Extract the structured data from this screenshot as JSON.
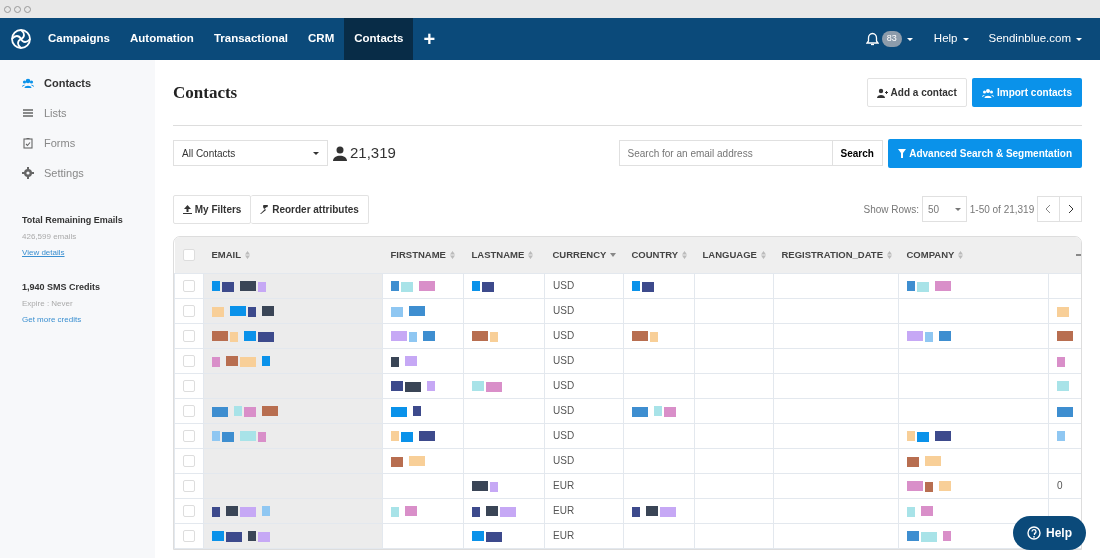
{
  "nav": {
    "items": [
      {
        "label": "Campaigns",
        "selected": false
      },
      {
        "label": "Automation",
        "selected": false
      },
      {
        "label": "Transactional",
        "selected": false
      },
      {
        "label": "CRM",
        "selected": false
      },
      {
        "label": "Contacts",
        "selected": true
      }
    ],
    "plus": "+",
    "notifications": "83",
    "help": "Help",
    "account": "Sendinblue.com"
  },
  "sidebar": {
    "items": [
      {
        "label": "Contacts",
        "selected": true
      },
      {
        "label": "Lists",
        "selected": false
      },
      {
        "label": "Forms",
        "selected": false
      },
      {
        "label": "Settings",
        "selected": false
      }
    ],
    "emails": {
      "title": "Total Remaining Emails",
      "count": "426,599 emails",
      "link": "View details"
    },
    "sms": {
      "title": "1,940 SMS Credits",
      "expire": "Expire : Never",
      "link": "Get more credits"
    }
  },
  "page": {
    "title": "Contacts",
    "add_button": "Add a contact",
    "import_button": "Import contacts",
    "list_select": "All Contacts",
    "contact_count": "21,319",
    "search": {
      "placeholder": "Search for an email address",
      "button": "Search"
    },
    "advanced_button": "Advanced Search & Segmentation",
    "filters_button": "My Filters",
    "reorder_button": "Reorder attributes",
    "show_rows_label": "Show Rows:",
    "show_rows": "50",
    "range": "1-50 of 21,319"
  },
  "table": {
    "select_all_checked": false,
    "columns": [
      {
        "label": "EMAIL",
        "kind": "sortable"
      },
      {
        "label": "FIRSTNAME",
        "kind": "sortable"
      },
      {
        "label": "LASTNAME",
        "kind": "sortable"
      },
      {
        "label": "CURRENCY",
        "kind": "sorted"
      },
      {
        "label": "COUNTRY",
        "kind": "sortable"
      },
      {
        "label": "LANGUAGE",
        "kind": "sortable"
      },
      {
        "label": "REGISTRATION_DATE",
        "kind": "sortable"
      },
      {
        "label": "COMPANY",
        "kind": "sortable"
      }
    ],
    "rows": [
      {
        "checked": false,
        "currency": "USD",
        "redacted": {
          "email": true,
          "firstname": true,
          "lastname": true,
          "country": true,
          "company": true,
          "extra": false
        }
      },
      {
        "checked": false,
        "currency": "USD",
        "redacted": {
          "email": true,
          "firstname": true,
          "lastname": false,
          "country": false,
          "company": false,
          "extra": true
        }
      },
      {
        "checked": false,
        "currency": "USD",
        "redacted": {
          "email": true,
          "firstname": true,
          "lastname": true,
          "country": true,
          "company": true,
          "extra": true
        }
      },
      {
        "checked": false,
        "currency": "USD",
        "redacted": {
          "email": true,
          "firstname": true,
          "lastname": false,
          "country": false,
          "company": false,
          "extra": true
        }
      },
      {
        "checked": false,
        "currency": "USD",
        "redacted": {
          "email": false,
          "firstname": true,
          "lastname": true,
          "country": false,
          "company": false,
          "extra": true
        }
      },
      {
        "checked": false,
        "currency": "USD",
        "redacted": {
          "email": true,
          "firstname": true,
          "lastname": false,
          "country": true,
          "company": false,
          "extra": true
        }
      },
      {
        "checked": false,
        "currency": "USD",
        "redacted": {
          "email": true,
          "firstname": true,
          "lastname": false,
          "country": false,
          "company": true,
          "extra": true
        }
      },
      {
        "checked": false,
        "currency": "USD",
        "redacted": {
          "email": false,
          "firstname": true,
          "lastname": false,
          "country": false,
          "company": true,
          "extra": false
        }
      },
      {
        "checked": false,
        "currency": "EUR",
        "extra": "0",
        "redacted": {
          "email": false,
          "firstname": false,
          "lastname": true,
          "country": false,
          "company": true,
          "extra": false
        }
      },
      {
        "checked": false,
        "currency": "EUR",
        "redacted": {
          "email": true,
          "firstname": true,
          "lastname": true,
          "country": true,
          "company": true,
          "extra": false
        }
      },
      {
        "checked": false,
        "currency": "EUR",
        "redacted": {
          "email": true,
          "firstname": false,
          "lastname": true,
          "country": false,
          "company": true,
          "extra": false
        }
      }
    ]
  },
  "help_button": "Help"
}
